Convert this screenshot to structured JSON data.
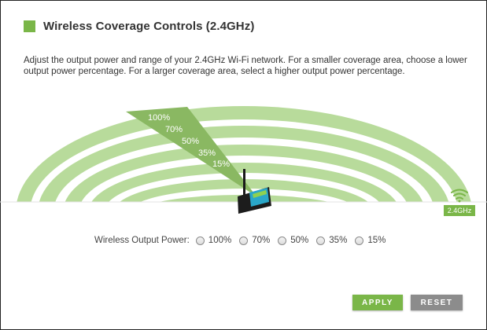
{
  "header": {
    "title": "Wireless Coverage Controls (2.4GHz)"
  },
  "description": "Adjust the output power and range of your 2.4GHz Wi-Fi network. For a smaller coverage area, choose a lower output power percentage. For a larger coverage area, select a higher output power percentage.",
  "coverage": {
    "levels": [
      "100%",
      "70%",
      "50%",
      "35%",
      "15%"
    ],
    "band_badge": "2.4GHz",
    "icons": [
      "router-icon",
      "wifi-icon"
    ]
  },
  "power": {
    "label": "Wireless Output Power:",
    "options": [
      "100%",
      "70%",
      "50%",
      "35%",
      "15%"
    ]
  },
  "buttons": {
    "apply": "APPLY",
    "reset": "RESET"
  },
  "colors": {
    "accent": "#7ab648",
    "reset": "#8c8c8c",
    "arc": "#b8db9b"
  }
}
